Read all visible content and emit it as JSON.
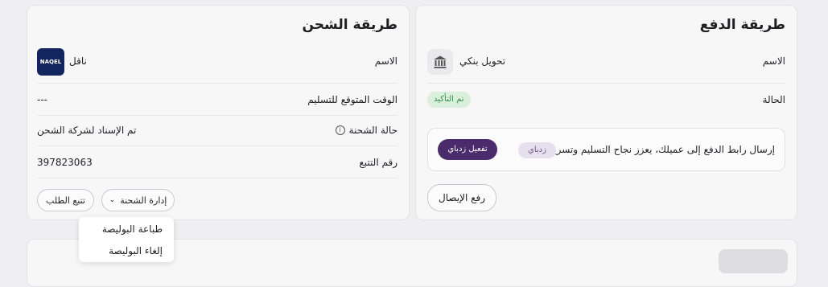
{
  "payment": {
    "title": "طريقة الدفع",
    "name_label": "الاسم",
    "name_value": "تحويل بنكي",
    "status_label": "الحالة",
    "status_badge": "تم التأكيد",
    "zidpay_text": "إرسال رابط الدفع إلى عميلك، يعزز نجاح التسليم وتسريع الدفع.",
    "zidpay_tag": "زدباي",
    "activate_label": "تفعيل زدباي",
    "upload_label": "رفع الإيصال"
  },
  "shipping": {
    "title": "طريقة الشحن",
    "name_label": "الاسم",
    "name_value": "ناقل",
    "logo_text": "NAQEL",
    "eta_label": "الوقت المتوقع للتسليم",
    "eta_value": "---",
    "status_label": "حالة الشحنة",
    "status_value": "تم الإسناد لشركة الشحن",
    "tracking_label": "رقم التتبع",
    "tracking_value": "397823063",
    "manage_label": "إدارة الشحنة",
    "track_label": "تتبع الطلب"
  },
  "dropdown": {
    "items": [
      "طباعة البوليصة",
      "إلغاء البوليصة"
    ]
  },
  "colors": {
    "primary": "#4a2b6b",
    "badge_bg": "#d9f0dc",
    "badge_fg": "#3c8a4a",
    "tag_bg": "#e6e0ee"
  }
}
